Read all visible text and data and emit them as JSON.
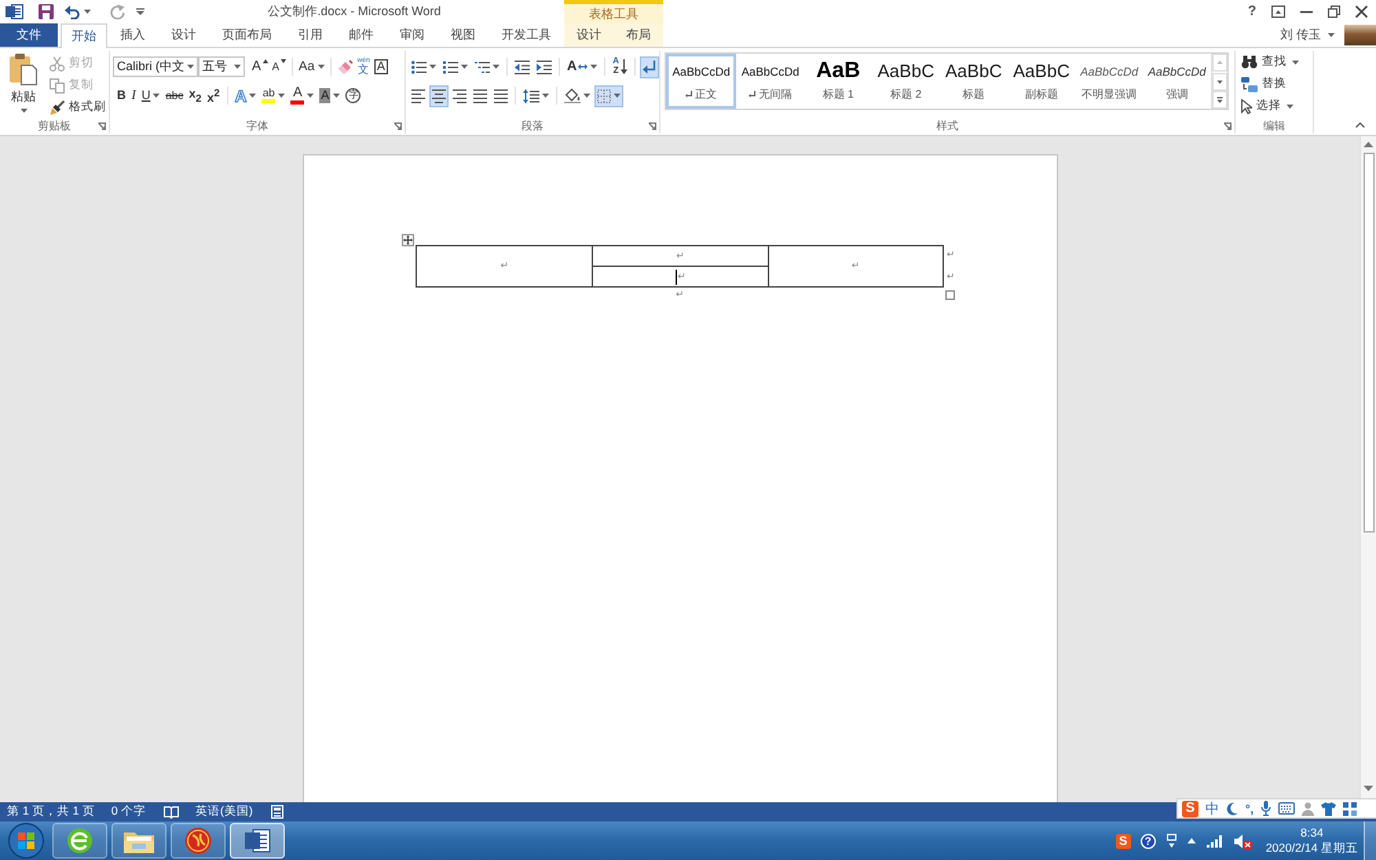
{
  "title_bar": {
    "title": "公文制作.docx - Microsoft Word",
    "context_header": "表格工具",
    "help": "?"
  },
  "tabs": [
    {
      "label": "文件",
      "kind": "file",
      "selected": false
    },
    {
      "label": "开始",
      "kind": "main",
      "selected": true
    },
    {
      "label": "插入",
      "kind": "main",
      "selected": false
    },
    {
      "label": "设计",
      "kind": "main",
      "selected": false
    },
    {
      "label": "页面布局",
      "kind": "main",
      "selected": false
    },
    {
      "label": "引用",
      "kind": "main",
      "selected": false
    },
    {
      "label": "邮件",
      "kind": "main",
      "selected": false
    },
    {
      "label": "审阅",
      "kind": "main",
      "selected": false
    },
    {
      "label": "视图",
      "kind": "main",
      "selected": false
    },
    {
      "label": "开发工具",
      "kind": "main",
      "selected": false
    },
    {
      "label": "设计",
      "kind": "context",
      "selected": false
    },
    {
      "label": "布局",
      "kind": "context",
      "selected": false
    }
  ],
  "user": {
    "name": "刘 传玉"
  },
  "clipboard": {
    "label": "剪贴板",
    "paste": "粘贴",
    "items": [
      {
        "label": "剪切",
        "kind": "cut",
        "disabled": true
      },
      {
        "label": "复制",
        "kind": "copy",
        "disabled": true
      },
      {
        "label": "格式刷",
        "kind": "painter",
        "disabled": false
      }
    ]
  },
  "font": {
    "label": "字体",
    "font_name": "Calibri (中文",
    "font_size": "五号",
    "row_1": [
      {
        "kind": "grow",
        "glyph": "A"
      },
      {
        "kind": "shrink",
        "glyph": "A"
      },
      {
        "kind": "case",
        "glyph": "Aa"
      },
      {
        "kind": "clear"
      },
      {
        "kind": "phonetic",
        "glyph": "文",
        "ruby": "wén"
      },
      {
        "kind": "border",
        "glyph": "A"
      }
    ],
    "row_2": [
      {
        "kind": "bold",
        "glyph": "B"
      },
      {
        "kind": "italic",
        "glyph": "I"
      },
      {
        "kind": "underline",
        "glyph": "U"
      },
      {
        "kind": "strike",
        "glyph": "abc"
      },
      {
        "kind": "sub",
        "glyph": "x$_{2}$"
      },
      {
        "kind": "sup",
        "glyph": "x$^{2}$"
      },
      {
        "kind": "effects",
        "glyph": "A"
      },
      {
        "kind": "highlight",
        "glyph": "ab",
        "color": "#ffff00"
      },
      {
        "kind": "color",
        "glyph": "A",
        "color": "#ff0000"
      },
      {
        "kind": "shading",
        "glyph": "A"
      },
      {
        "kind": "enclose",
        "glyph": "字"
      }
    ]
  },
  "paragraph": {
    "label": "段落",
    "row_1": [
      {
        "kind": "bullets",
        "on": false
      },
      {
        "kind": "numbering",
        "on": false
      },
      {
        "kind": "multilevel",
        "on": false
      },
      {
        "kind": "outdent",
        "on": false
      },
      {
        "kind": "indent",
        "on": false
      },
      {
        "kind": "asian_layout",
        "glyph": "A",
        "on": false
      },
      {
        "kind": "sort",
        "glyph": "A",
        "glyph_2": "Z",
        "on": false
      },
      {
        "kind": "marks",
        "on": true
      }
    ],
    "row_2": [
      {
        "kind": "left",
        "on": false
      },
      {
        "kind": "center",
        "on": true
      },
      {
        "kind": "right",
        "on": false
      },
      {
        "kind": "justify",
        "on": false
      },
      {
        "kind": "distribute",
        "on": false
      },
      {
        "kind": "spacing",
        "on": false
      },
      {
        "kind": "shading",
        "on": false
      },
      {
        "kind": "borders",
        "on": true
      }
    ]
  },
  "styles": {
    "label": "样式",
    "items": [
      {
        "preview": "AaBbCcDd",
        "name": "正文",
        "kind": "normal",
        "para_mark": true,
        "selected": true
      },
      {
        "preview": "AaBbCcDd",
        "name": "无间隔",
        "kind": "normal",
        "para_mark": true,
        "selected": false
      },
      {
        "preview": "AaB",
        "name": "标题 1",
        "kind": "heading1",
        "para_mark": false,
        "selected": false
      },
      {
        "preview": "AaBbC",
        "name": "标题 2",
        "kind": "heading2",
        "para_mark": false,
        "selected": false
      },
      {
        "preview": "AaBbC",
        "name": "标题",
        "kind": "title",
        "para_mark": false,
        "selected": false
      },
      {
        "preview": "AaBbC",
        "name": "副标题",
        "kind": "subtitle",
        "para_mark": false,
        "selected": false
      },
      {
        "preview": "AaBbCcDd",
        "name": "不明显强调",
        "kind": "subtle",
        "para_mark": false,
        "selected": false
      },
      {
        "preview": "AaBbCcDd",
        "name": "强调",
        "kind": "emphasis",
        "para_mark": false,
        "selected": false
      }
    ]
  },
  "editing": {
    "label": "编辑",
    "items": [
      {
        "label": "查找",
        "kind": "find"
      },
      {
        "label": "替换",
        "kind": "replace"
      },
      {
        "label": "选择",
        "kind": "select"
      }
    ]
  },
  "document": {
    "table": {
      "columns": [
        {
          "cells": [
            {
              "mark": "↵",
              "cursor": false
            }
          ]
        },
        {
          "cells": [
            {
              "mark": "↵",
              "cursor": false
            },
            {
              "mark": "↵",
              "cursor": true
            }
          ]
        },
        {
          "cells": [
            {
              "mark": "↵",
              "cursor": false
            }
          ]
        }
      ],
      "row_end_marks": [
        "↵",
        "↵"
      ]
    },
    "after_mark": "↵"
  },
  "status_bar": {
    "page": "第 1 页，共 1 页",
    "words": "0 个字",
    "language": "英语(美国)"
  },
  "ime_bar": {
    "logo": "S",
    "mode": "中",
    "punctuation": "°,"
  },
  "taskbar": {
    "apps": [
      {
        "kind": "browser",
        "active": false
      },
      {
        "kind": "explorer",
        "active": false
      },
      {
        "kind": "emblem",
        "active": false
      },
      {
        "kind": "word",
        "active": true
      }
    ],
    "tray": {
      "ime_logo": "S",
      "help": "?"
    },
    "time": "8:34",
    "date": "2020/2/14 星期五"
  }
}
